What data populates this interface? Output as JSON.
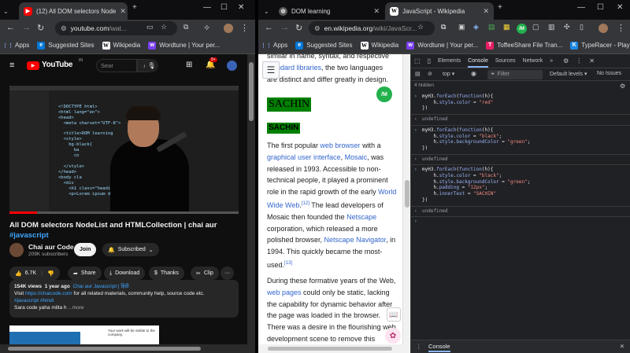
{
  "left_window": {
    "tab_title": "(12) All DOM selectors Node",
    "url_host": "youtube.com",
    "url_path": "/wat...",
    "bookmarks": [
      {
        "label": "Apps"
      },
      {
        "label": "Suggested Sites"
      },
      {
        "label": "Wikipedia"
      },
      {
        "label": "Wordtune | Your per..."
      }
    ],
    "youtube": {
      "logo": "YouTube",
      "logo_suffix": "IN",
      "search_placeholder": "Sear",
      "notification_count": "9+",
      "video_title": "All DOM selectors NodeList and HTMLCollection | chai aur",
      "video_tag": "#javascript",
      "channel_name": "Chai aur Code",
      "subscribers": "209K subscribers",
      "join_label": "Join",
      "subscribed_label": "Subscribed",
      "likes": "6.7K",
      "share_label": "Share",
      "download_label": "Download",
      "thanks_label": "Thanks",
      "clip_label": "Clip",
      "more_label": "···",
      "views": "154K views",
      "age": "1 year ago",
      "playlist": "Chai aur Javascript | हिंदी",
      "desc_visit": "Visit",
      "desc_link": "https://chaicode.com",
      "desc_rest": "for all related materials, community help, source code etc.",
      "desc_tags": "#javascript #hindi",
      "desc_last": "Sara code yaha milta h",
      "desc_more": "...more",
      "video_code_lines": [
        "<!DOCTYPE html>",
        "<html lang=\"en\">",
        "<head>",
        "  <meta charset=\"UTF-8\">",
        "",
        "  <title>DOM learning",
        "  <style>",
        "    bg-black{",
        "      ba",
        "      co",
        "  </style>",
        "</head>",
        "<body cla",
        "  <div",
        "    <h1 class=\"heading\">DOM learning on Chai",
        "    <p>Lorem ipsum dolor sit amet.</p>"
      ],
      "next_thumb_text": "Your work will be visible to the company."
    }
  },
  "right_window": {
    "tabs": [
      {
        "title": "DOM learning"
      },
      {
        "title": "JavaScript - Wikipedia"
      }
    ],
    "url_host": "en.wikipedia.org",
    "url_path": "/wiki/JavaScr...",
    "bookmarks": [
      {
        "label": "Apps"
      },
      {
        "label": "Suggested Sites"
      },
      {
        "label": "Wikipedia"
      },
      {
        "label": "Wordtune | Your per..."
      },
      {
        "label": "ToffeeShare File Tran..."
      },
      {
        "label": "TypeRacer - Play Typ..."
      }
    ],
    "wiki": {
      "top_line_1": "similar in name, syntax, and respective",
      "top_line_2a": "standard libraries",
      "top_line_2b": ", the two languages",
      "top_line_3": "are distinct and differ greatly in design.",
      "sachin_heading": "SACHIN",
      "sachin_para": "SACHIN",
      "p1": [
        {
          "t": "The first popular "
        },
        {
          "t": "web browser",
          "link": true
        },
        {
          "t": " with a "
        },
        {
          "t": "graphical user interface",
          "link": true
        },
        {
          "t": ", "
        },
        {
          "t": "Mosaic",
          "link": true
        },
        {
          "t": ", was released in 1993. Accessible to non-technical people, it played a prominent role in the rapid growth of the early "
        },
        {
          "t": "World Wide Web",
          "link": true
        },
        {
          "t": ".",
          "sup": "[12]"
        },
        {
          "t": " The lead developers of Mosaic then founded the "
        },
        {
          "t": "Netscape",
          "link": true
        },
        {
          "t": " corporation, which released a more polished browser, "
        },
        {
          "t": "Netscape Navigator",
          "link": true
        },
        {
          "t": ", in 1994. This quickly became the most-used.",
          "sup": "[13]"
        }
      ],
      "p2": [
        {
          "t": "During these formative years of the Web, "
        },
        {
          "t": "web pages",
          "link": true
        },
        {
          "t": " could only be static, lacking the capability for dynamic behavior after the page was loaded in the browser. There was a desire in the flourishing web development scene to remove this limitation, so in 1995,"
        }
      ]
    },
    "devtools": {
      "tabs": [
        "Elements",
        "Console",
        "Sources",
        "Network",
        "»"
      ],
      "active_tab": "Console",
      "context": "top",
      "filter_placeholder": "Filter",
      "levels": "Default levels",
      "issues": "No Issues",
      "hidden": "4 hidden",
      "undefined": "undefined",
      "entries": [
        [
          "myH3.forEach(function(h){",
          "    h.style.color = \"red\"",
          "})"
        ],
        [
          "myH3.forEach(function(h){",
          "    h.style.color = \"black\";",
          "    h.style.backgroundColor = \"green\";",
          "})"
        ],
        [
          "myH3.forEach(function(h){",
          "    h.style.color = \"black\";",
          "    h.style.backgroundColor = \"green\";",
          "    h.padding = \"12px\";",
          "    h.innerText = \"SACHIN\"",
          "})"
        ]
      ],
      "drawer_label": "Console"
    }
  },
  "colors": {
    "youtube_red": "#ff0000",
    "link_blue": "#3366cc",
    "sachin_green": "#008000",
    "devtools_bg": "#202124",
    "console_string": "#f28b82"
  }
}
